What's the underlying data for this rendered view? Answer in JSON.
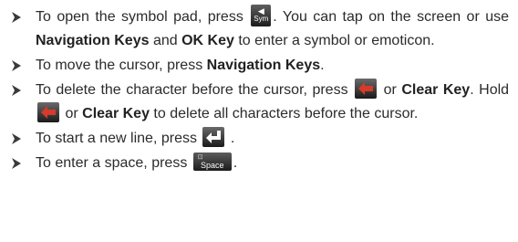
{
  "items": [
    {
      "t1": "To open the symbol pad, press",
      "t2": ". You can tap on the screen or use",
      "b1": "Navigation Keys",
      "t3": "and",
      "b2": "OK Key",
      "t4": "to enter a symbol or emoticon."
    },
    {
      "t1": "To move the cursor, press",
      "b1": "Navigation Keys",
      "t2": "."
    },
    {
      "t1": "To delete the character before the cursor, press",
      "t2": "or",
      "b1": "Clear Key",
      "t3": ". Hold",
      "t4": "or",
      "b2": "Clear Key",
      "t5": "to delete all characters before the cursor."
    },
    {
      "t1": "To start a new line, press",
      "t2": "."
    },
    {
      "t1": "To enter a space, press",
      "t2": "."
    }
  ],
  "icons": {
    "bullet": "arrow-bullet-icon",
    "symbol_key": "sym-key-icon",
    "backspace_key": "backspace-key-icon",
    "enter_key": "enter-key-icon",
    "space_key": "space-key-icon"
  },
  "keys": {
    "sym_label": "Sym",
    "space_label": "Space"
  },
  "colors": {
    "text": "#2b2b2b",
    "key_background": "#1c1c1c",
    "backspace_arrow": "#d63a2a",
    "enter_arrow": "#ffffff"
  }
}
